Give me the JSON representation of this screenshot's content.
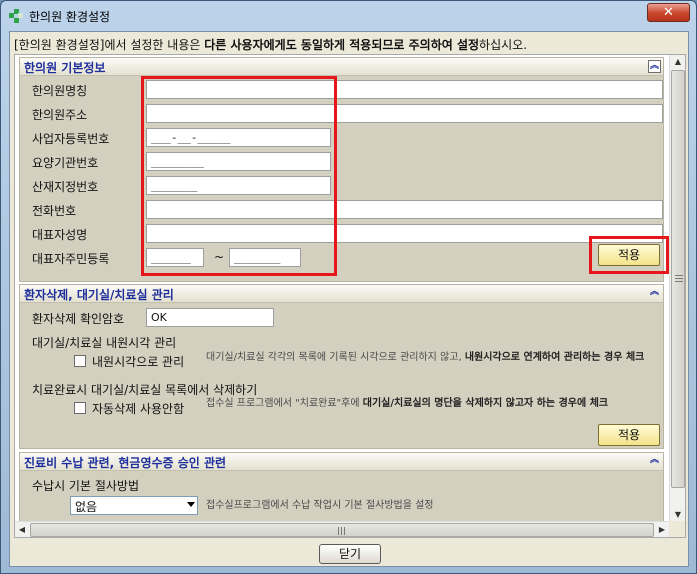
{
  "window": {
    "title": "한의원 환경설정",
    "close_glyph": "✕"
  },
  "notice": {
    "prefix": "[한의원 환경설정]에서 설정한 내용은 ",
    "bold1": "다른 사용자에게도 동일하게 적용되므로 주의하여 설정",
    "suffix": "하십시오."
  },
  "section1": {
    "title": "한의원 기본정보",
    "fields": [
      {
        "label": "한의원명칭",
        "value": ""
      },
      {
        "label": "한의원주소",
        "value": ""
      },
      {
        "label": "사업자등록번호",
        "value": "___-__-_____"
      },
      {
        "label": "요양기관번호",
        "value": "________"
      },
      {
        "label": "산재지정번호",
        "value": "_______"
      },
      {
        "label": "전화번호",
        "value": ""
      },
      {
        "label": "대표자성명",
        "value": ""
      },
      {
        "label": "대표자주민등록",
        "value": "______"
      }
    ],
    "rrn_separator": "~",
    "rrn_second": "_______",
    "apply_label": "적용"
  },
  "section2": {
    "title": "환자삭제, 대기실/치료실 관리",
    "confirm_label": "환자삭제 확인암호",
    "confirm_value": "OK",
    "arrival_heading": "대기실/치료실 내원시각 관리",
    "arrival_checkbox": "내원시각으로 관리",
    "arrival_desc_1": "대기실/치료실 각각의 목록에 기록된 시각으로 관리하지 않고, ",
    "arrival_desc_bold": "내원시각으로 연계하여 관리하는 경우 체크",
    "autodelete_heading": "치료완료시 대기실/치료실 목록에서 삭제하기",
    "autodelete_checkbox": "자동삭제 사용안함",
    "autodelete_desc_1": "접수실 프로그램에서 \"치료완료\"후에 ",
    "autodelete_desc_bold": "대기실/치료실의 명단을 삭제하지 않고자 하는 경우에 체크",
    "apply_label": "적용"
  },
  "section3": {
    "title": "진료비 수납 관련, 현금영수증 승인 관련",
    "method_heading": "수납시 기본 절사방법",
    "method_selected": "없음",
    "method_desc": "접수실프로그램에서 수납 작업시 기본 절사방법을 설정"
  },
  "footer": {
    "close_label": "닫기"
  }
}
